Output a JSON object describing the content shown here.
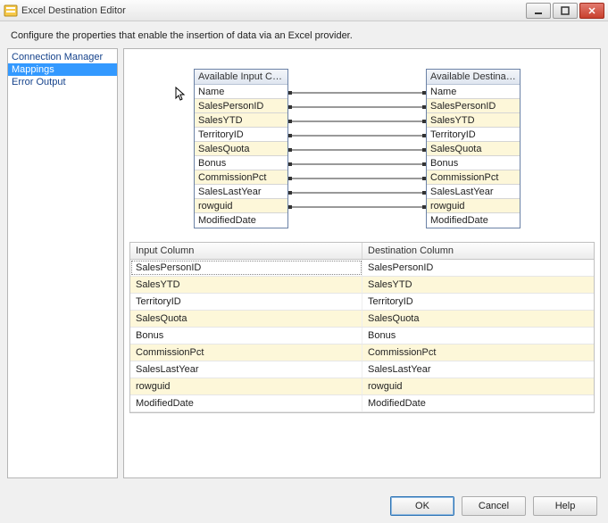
{
  "window": {
    "title": "Excel Destination Editor",
    "description": "Configure the properties that enable the insertion of data via an Excel provider."
  },
  "nav": {
    "items": [
      {
        "label": "Connection Manager",
        "selected": false
      },
      {
        "label": "Mappings",
        "selected": true
      },
      {
        "label": "Error Output",
        "selected": false
      }
    ]
  },
  "diagram": {
    "left_header": "Available Input Col...",
    "right_header": "Available Destinatio...",
    "columns": [
      "Name",
      "SalesPersonID",
      "SalesYTD",
      "TerritoryID",
      "SalesQuota",
      "Bonus",
      "CommissionPct",
      "SalesLastYear",
      "rowguid",
      "ModifiedDate"
    ]
  },
  "grid": {
    "headers": {
      "input": "Input Column",
      "dest": "Destination Column"
    },
    "rows": [
      {
        "input": "SalesPersonID",
        "dest": "SalesPersonID"
      },
      {
        "input": "SalesYTD",
        "dest": "SalesYTD"
      },
      {
        "input": "TerritoryID",
        "dest": "TerritoryID"
      },
      {
        "input": "SalesQuota",
        "dest": "SalesQuota"
      },
      {
        "input": "Bonus",
        "dest": "Bonus"
      },
      {
        "input": "CommissionPct",
        "dest": "CommissionPct"
      },
      {
        "input": "SalesLastYear",
        "dest": "SalesLastYear"
      },
      {
        "input": "rowguid",
        "dest": "rowguid"
      },
      {
        "input": "ModifiedDate",
        "dest": "ModifiedDate"
      }
    ]
  },
  "buttons": {
    "ok": "OK",
    "cancel": "Cancel",
    "help": "Help"
  }
}
